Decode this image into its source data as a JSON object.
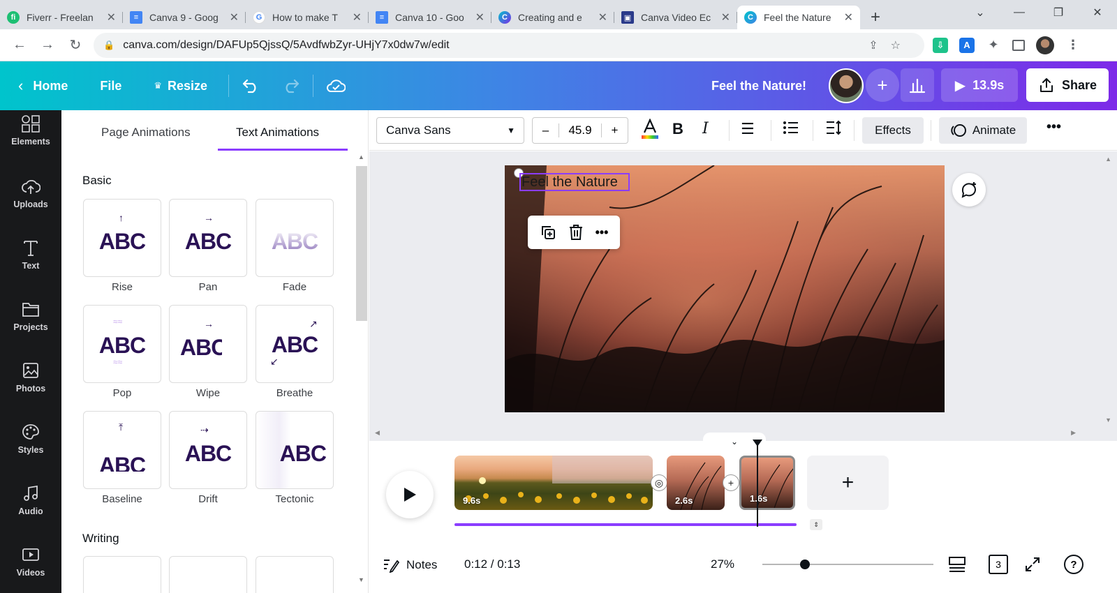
{
  "browser": {
    "tabs": [
      {
        "title": "Fiverr - Freelan",
        "favicon_color": "#1dbf73",
        "favicon": "fi"
      },
      {
        "title": "Canva 9 - Goog",
        "favicon_color": "#4285f4",
        "favicon": "≡"
      },
      {
        "title": "How to make T",
        "favicon_color": "#ffffff",
        "favicon": "G"
      },
      {
        "title": "Canva 10 - Goo",
        "favicon_color": "#4285f4",
        "favicon": "≡"
      },
      {
        "title": "Creating and e",
        "favicon_color": "#7d2ae8",
        "favicon": "C"
      },
      {
        "title": "Canva Video Ec",
        "favicon_color": "#2a3a8a",
        "favicon": "▣"
      },
      {
        "title": "Feel the Nature",
        "favicon_color": "#1ea5e0",
        "favicon": "C",
        "active": true
      }
    ],
    "url": "canva.com/design/DAFUp5QjssQ/5AvdfwbZyr-UHjY7x0dw7w/edit"
  },
  "header": {
    "home": "Home",
    "file": "File",
    "resize": "Resize",
    "design_title": "Feel the Nature!",
    "play_duration": "13.9s",
    "share": "Share",
    "gradient": [
      "#00c4cc",
      "#7d2ae8"
    ]
  },
  "sidebar": {
    "items": [
      {
        "label": "Elements",
        "icon": "elements-icon"
      },
      {
        "label": "Uploads",
        "icon": "cloud-upload-icon"
      },
      {
        "label": "Text",
        "icon": "text-t-icon"
      },
      {
        "label": "Projects",
        "icon": "folder-icon"
      },
      {
        "label": "Photos",
        "icon": "image-icon"
      },
      {
        "label": "Styles",
        "icon": "palette-icon"
      },
      {
        "label": "Audio",
        "icon": "music-note-icon"
      },
      {
        "label": "Videos",
        "icon": "video-icon"
      }
    ]
  },
  "panel": {
    "tabs": [
      "Page Animations",
      "Text Animations"
    ],
    "active_tab": "Text Animations",
    "sections": {
      "basic": "Basic",
      "writing": "Writing"
    },
    "card_text": "ABC",
    "animations": [
      {
        "label": "Rise"
      },
      {
        "label": "Pan"
      },
      {
        "label": "Fade"
      },
      {
        "label": "Pop"
      },
      {
        "label": "Wipe"
      },
      {
        "label": "Breathe"
      },
      {
        "label": "Baseline"
      },
      {
        "label": "Drift"
      },
      {
        "label": "Tectonic"
      }
    ]
  },
  "toolbar": {
    "font": "Canva Sans",
    "font_size": "45.9",
    "minus": "–",
    "plus": "+",
    "effects": "Effects",
    "animate": "Animate"
  },
  "canvas": {
    "text": "Feel the Nature"
  },
  "timeline": {
    "clips": [
      {
        "duration": "9.6s"
      },
      {
        "duration": "2.6s"
      },
      {
        "duration": "1.6s"
      }
    ]
  },
  "footer": {
    "notes": "Notes",
    "time": "0:12 / 0:13",
    "zoom": "27%",
    "page_count": "3",
    "zoom_level_fraction": 0.27
  }
}
